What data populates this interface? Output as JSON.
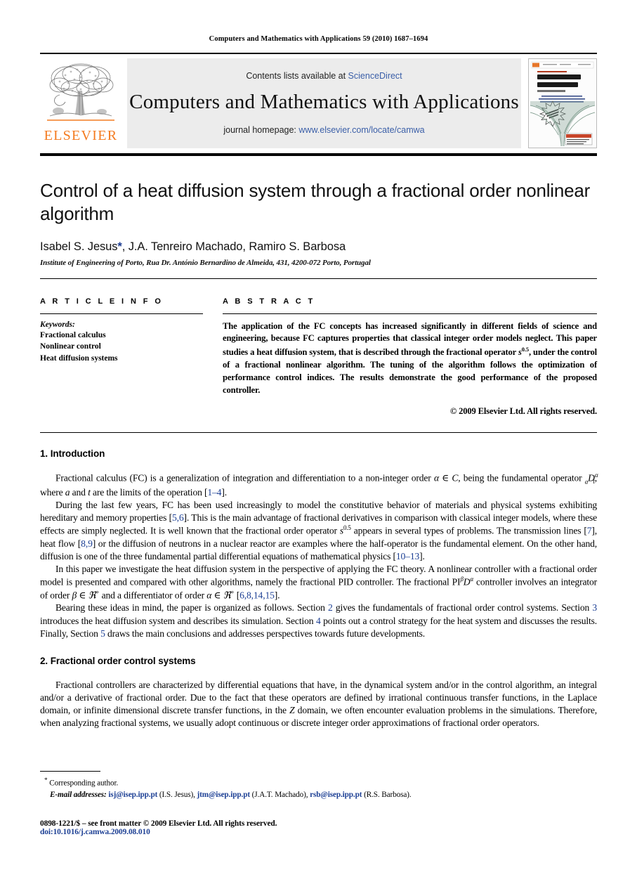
{
  "running_head": "Computers and Mathematics with Applications 59 (2010) 1687–1694",
  "masthead": {
    "contents_prefix": "Contents lists available at ",
    "contents_link": "ScienceDirect",
    "journal_title": "Computers and Mathematics with Applications",
    "homepage_prefix": "journal homepage: ",
    "homepage_url": "www.elsevier.com/locate/camwa",
    "publisher_wordmark": "ELSEVIER",
    "publisher_logo_icon": "elsevier-tree-icon",
    "cover": {
      "top_strip": "An International Journal",
      "line1": "computers &",
      "line2": "mathematics",
      "line3": "with applications",
      "burst": "Available online"
    }
  },
  "article": {
    "title": "Control of a heat diffusion system through a fractional order nonlinear algorithm",
    "authors": "Isabel S. Jesus",
    "authors_star": "*",
    "authors_rest": ", J.A. Tenreiro Machado, Ramiro S. Barbosa",
    "affiliation": "Institute of Engineering of Porto, Rua Dr. António Bernardino de Almeida, 431, 4200-072 Porto, Portugal"
  },
  "info": {
    "heading": "A R T I C L E    I N F O",
    "keywords_label": "Keywords:",
    "keywords": [
      "Fractional calculus",
      "Nonlinear control",
      "Heat diffusion systems"
    ]
  },
  "abstract": {
    "heading": "A B S T R A C T",
    "text_part1": "The application of the FC concepts has increased significantly in different fields of science and engineering, because FC captures properties that classical integer order models neglect. This paper studies a heat diffusion system, that is described through the fractional operator ",
    "operator_base": "s",
    "operator_exp": "0.5",
    "text_part2": ", under the control of a fractional nonlinear algorithm. The tuning of the algorithm follows the optimization of performance control indices. The results demonstrate the good performance of the proposed controller.",
    "copyright": "© 2009 Elsevier Ltd. All rights reserved."
  },
  "sections": [
    {
      "number": "1.",
      "title": "Introduction",
      "heading": "1.  Introduction"
    },
    {
      "number": "2.",
      "title": "Fractional order control systems",
      "heading": "2.  Fractional order control systems"
    }
  ],
  "intro": {
    "p1_a": "Fractional calculus (FC) is a generalization of integration and differentiation to a non-integer order ",
    "p1_alpha": "α ∈ C",
    "p1_b": ", being the fundamental operator ",
    "p1_op_pre": "a",
    "p1_op_D": "D",
    "p1_op_t": "t",
    "p1_op_alpha": "α",
    "p1_c": ", where ",
    "p1_a_var": "a",
    "p1_d": " and ",
    "p1_t_var": "t",
    "p1_e": " are the limits of the operation [",
    "p1_ref": "1–4",
    "p1_f": "].",
    "p2_a": "During the last few years, FC has been used increasingly to model the constitutive behavior of materials and physical systems exhibiting hereditary and memory properties [",
    "p2_ref1": "5,6",
    "p2_b": "]. This is the main advantage of fractional derivatives in comparison with classical integer models, where these effects are simply neglected. It is well known that the fractional order operator ",
    "p2_op": "s",
    "p2_op_exp": "0.5",
    "p2_c": " appears in several types of problems. The transmission lines [",
    "p2_ref2": "7",
    "p2_d": "], heat flow [",
    "p2_ref3": "8,9",
    "p2_e": "] or the diffusion of neutrons in a nuclear reactor are examples where the half-operator is the fundamental element. On the other hand, diffusion is one of the three fundamental partial differential equations of mathematical physics [",
    "p2_ref4": "10–13",
    "p2_f": "].",
    "p3_a": "In this paper we investigate the heat diffusion system in the perspective of applying the FC theory. A nonlinear controller with a fractional order model is presented and compared with other algorithms, namely the fractional PID controller. The fractional PI",
    "p3_beta_sup": "β",
    "p3_D": "D",
    "p3_alpha_sup": "α",
    "p3_b": " controller involves an integrator of order ",
    "p3_beta": "β ∈ ℜ",
    "p3_plus1": "+",
    "p3_c": " and a differentiator of order ",
    "p3_alpha": "α ∈ ℜ",
    "p3_plus2": "+",
    "p3_d": " [",
    "p3_ref": "6,8,14,15",
    "p3_e": "].",
    "p4_a": "Bearing these ideas in mind, the paper is organized as follows. Section ",
    "p4_s2": "2",
    "p4_b": " gives the fundamentals of fractional order control systems. Section ",
    "p4_s3": "3",
    "p4_c": " introduces the heat diffusion system and describes its simulation. Section ",
    "p4_s4": "4",
    "p4_d": " points out a control strategy for the heat system and discusses the results. Finally, Section ",
    "p4_s5": "5",
    "p4_e": " draws the main conclusions and addresses perspectives towards future developments."
  },
  "section2": {
    "p1_a": "Fractional controllers are characterized by differential equations that have, in the dynamical system and/or in the control algorithm, an integral and/or a derivative of fractional order. Due to the fact that these operators are defined by irrational continuous transfer functions, in the Laplace domain, or infinite dimensional discrete transfer functions, in the ",
    "p1_Z": "Z",
    "p1_b": " domain, we often encounter evaluation problems in the simulations. Therefore, when analyzing fractional systems, we usually adopt continuous or discrete integer order approximations of fractional order operators."
  },
  "footnotes": {
    "star": "*",
    "corresponding": "Corresponding author.",
    "email_label": "E-mail addresses:",
    "emails": [
      {
        "address": "isj@isep.ipp.pt",
        "person": "(I.S. Jesus)"
      },
      {
        "address": "jtm@isep.ipp.pt",
        "person": "(J.A.T. Machado)"
      },
      {
        "address": "rsb@isep.ipp.pt",
        "person": "(R.S. Barbosa)"
      }
    ],
    "issn": "0898-1221/$ – see front matter © 2009 Elsevier Ltd. All rights reserved.",
    "doi": "doi:10.1016/j.camwa.2009.08.010"
  },
  "colors": {
    "link_blue": "#3b5fa8",
    "ref_blue": "#1c3f94",
    "elsevier_orange": "#F47B20",
    "band_gray": "#ececec"
  }
}
